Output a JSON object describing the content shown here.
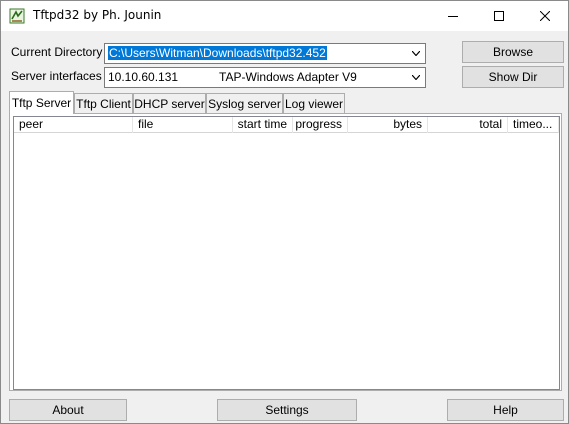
{
  "window": {
    "title": "Tftpd32 by Ph. Jounin"
  },
  "controls": {
    "current_directory_label": "Current Directory",
    "current_directory_value": "C:\\Users\\Witman\\Downloads\\tftpd32.452",
    "server_interfaces_label": "Server interfaces",
    "server_interface_ip": "10.10.60.131",
    "server_interface_adapter": "TAP-Windows Adapter V9",
    "browse_label": "Browse",
    "show_dir_label": "Show Dir"
  },
  "tabs": [
    {
      "label": "Tftp Server",
      "active": true
    },
    {
      "label": "Tftp Client",
      "active": false
    },
    {
      "label": "DHCP server",
      "active": false
    },
    {
      "label": "Syslog server",
      "active": false
    },
    {
      "label": "Log viewer",
      "active": false
    }
  ],
  "table": {
    "columns": [
      "peer",
      "file",
      "start time",
      "progress",
      "bytes",
      "total",
      "timeo..."
    ],
    "rows": []
  },
  "footer": {
    "about_label": "About",
    "settings_label": "Settings",
    "help_label": "Help"
  },
  "colors": {
    "selection": "#0078d7",
    "window_bg": "#f0f0f0",
    "button_bg": "#e1e1e1"
  }
}
